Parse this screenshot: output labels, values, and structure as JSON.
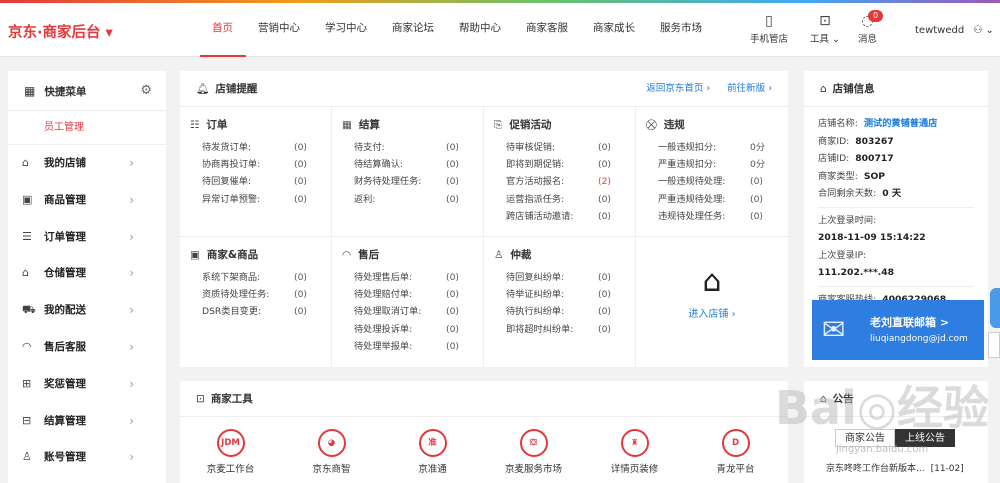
{
  "brand": {
    "logo": "京东·商家后台 ▾"
  },
  "nav": [
    "首页",
    "营销中心",
    "学习中心",
    "商家论坛",
    "帮助中心",
    "商家客服",
    "商家成长",
    "服务市场"
  ],
  "top_icons": [
    {
      "icon": "phone-icon",
      "glyph": "▯",
      "label": "手机管店"
    },
    {
      "icon": "toolbox-icon",
      "glyph": "⊡",
      "label": "工具 ⌄"
    },
    {
      "icon": "chat-icon",
      "glyph": "◌",
      "label": "消息"
    }
  ],
  "message_badge": "0",
  "user": {
    "name": "tewtwedd",
    "icon": "person-icon ⌄"
  },
  "sidebar": {
    "title": "快捷菜单",
    "sub": "员工管理",
    "items": [
      {
        "icon": "store-icon",
        "label": "我的店铺"
      },
      {
        "icon": "goods-icon",
        "label": "商品管理"
      },
      {
        "icon": "order-icon",
        "label": "订单管理"
      },
      {
        "icon": "warehouse-icon",
        "label": "仓储管理"
      },
      {
        "icon": "truck-icon",
        "label": "我的配送"
      },
      {
        "icon": "headset-icon",
        "label": "售后客服"
      },
      {
        "icon": "reward-icon",
        "label": "奖惩管理"
      },
      {
        "icon": "settlement-icon",
        "label": "结算管理"
      },
      {
        "icon": "account-icon",
        "label": "账号管理"
      }
    ]
  },
  "reminders": {
    "title": "店铺提醒",
    "link1": "返回京东首页 ›",
    "link2": "前往新版 ›",
    "sections": [
      {
        "title": "订单",
        "icon": "order-list-icon",
        "rows": [
          [
            "待发货订单:",
            "(0)"
          ],
          [
            "协商再投订单:",
            "(0)"
          ],
          [
            "待回复催单:",
            "(0)"
          ],
          [
            "异常订单预警:",
            "(0)"
          ]
        ]
      },
      {
        "title": "结算",
        "icon": "calculator-icon",
        "rows": [
          [
            "待支付:",
            "(0)"
          ],
          [
            "待结算确认:",
            "(0)"
          ],
          [
            "财务待处理任务:",
            "(0)"
          ],
          [
            "返利:",
            "(0)"
          ]
        ]
      },
      {
        "title": "促销活动",
        "icon": "promo-icon",
        "rows": [
          [
            "待审核促销:",
            "(0)"
          ],
          [
            "即将到期促销:",
            "(0)"
          ],
          [
            "官方活动报名:",
            "(2)"
          ],
          [
            "运营指派任务:",
            "(0)"
          ],
          [
            "跨店铺活动邀请:",
            "(0)"
          ]
        ]
      },
      {
        "title": "违规",
        "icon": "violation-icon",
        "rows": [
          [
            "一般违规扣分:",
            "0分"
          ],
          [
            "严重违规扣分:",
            "0分"
          ],
          [
            "一般违规待处理:",
            "(0)"
          ],
          [
            "严重违规待处理:",
            "(0)"
          ],
          [
            "违规待处理任务:",
            "(0)"
          ]
        ]
      },
      {
        "title": "商家&商品",
        "icon": "merchant-goods-icon",
        "rows": [
          [
            "系统下架商品:",
            "(0)"
          ],
          [
            "资质待处理任务:",
            "(0)"
          ],
          [
            "DSR类目变更:",
            "(0)"
          ]
        ]
      },
      {
        "title": "售后",
        "icon": "after-sale-icon",
        "rows": [
          [
            "待处理售后单:",
            "(0)"
          ],
          [
            "待处理赔付单:",
            "(0)"
          ],
          [
            "待处理取消订单:",
            "(0)"
          ],
          [
            "待处理投诉单:",
            "(0)"
          ],
          [
            "待处理举报单:",
            "(0)"
          ]
        ]
      },
      {
        "title": "仲裁",
        "icon": "arbitration-icon",
        "rows": [
          [
            "待回复纠纷单:",
            "(0)"
          ],
          [
            "待举证纠纷单:",
            "(0)"
          ],
          [
            "待执行纠纷单:",
            "(0)"
          ],
          [
            "即将超时纠纷单:",
            "(0)"
          ]
        ]
      }
    ],
    "store_link": "进入店铺 ›"
  },
  "tools": {
    "title": "商家工具",
    "items": [
      {
        "icon": "jdm-icon",
        "glyph": "JDM",
        "label": "京麦工作台"
      },
      {
        "icon": "jd-smart-icon",
        "glyph": "◕",
        "label": "京东商智"
      },
      {
        "icon": "zhuntong-icon",
        "glyph": "准",
        "label": "京准通"
      },
      {
        "icon": "service-market-icon",
        "glyph": "⛋",
        "label": "京麦服务市场"
      },
      {
        "icon": "page-decor-icon",
        "glyph": "♜",
        "label": "详情页装修"
      },
      {
        "icon": "qinglong-icon",
        "glyph": "D",
        "label": "青龙平台"
      }
    ]
  },
  "store_info": {
    "title": "店铺信息",
    "name_label": "店铺名称:",
    "name": "测试的黄铺普通店",
    "merchant_id_label": "商家ID:",
    "merchant_id": "803267",
    "shop_id_label": "店铺ID:",
    "shop_id": "800717",
    "type_label": "商家类型:",
    "type": "SOP",
    "contract_label": "合同剩余天数:",
    "contract": "0 天",
    "last_login_label": "上次登录时间:",
    "last_login": "2018-11-09 15:14:22",
    "last_ip_label": "上次登录IP:",
    "last_ip": "111.202.***.48",
    "hotline_label": "商家客服热线:",
    "hotline": "4006229068",
    "banner_title": "老刘直联邮箱 >",
    "banner_email": "liuqiangdong@jd.com"
  },
  "notices": {
    "title": "公告",
    "tabs": [
      "商家公告",
      "上线公告"
    ],
    "item": "京东咚咚工作台新版本...",
    "date": "[11-02]"
  },
  "watermark": {
    "main": "Bai◎经验",
    "url": "jingyan.baidu.com"
  }
}
